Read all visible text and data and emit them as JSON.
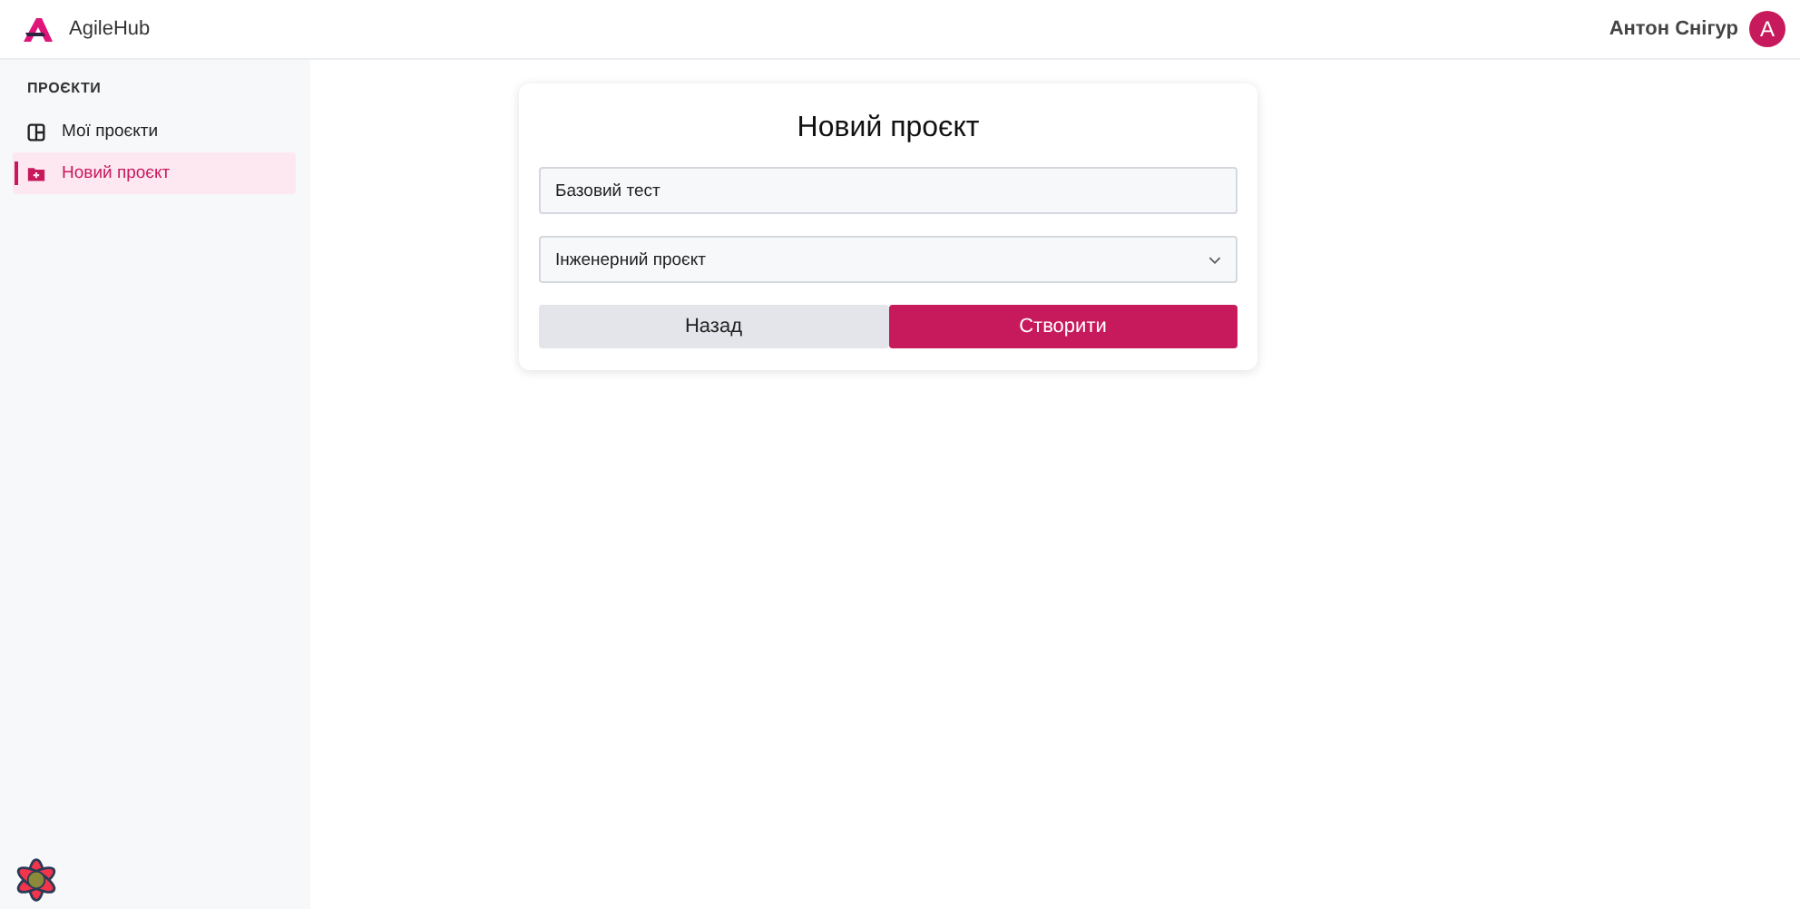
{
  "header": {
    "app_name": "AgileHub",
    "user_name": "Антон Снігур",
    "avatar_letter": "A"
  },
  "sidebar": {
    "section": "ПРОЄКТИ",
    "items": [
      {
        "label": "Мої проєкти",
        "kind": "board",
        "selected": false
      },
      {
        "label": "Новий проєкт",
        "kind": "folder",
        "selected": true
      }
    ]
  },
  "form": {
    "title": "Новий проєкт",
    "name_value": "Базовий тест",
    "type_value": "Інженерний проєкт",
    "buttons": [
      {
        "label": "Назад",
        "kind": "secondary"
      },
      {
        "label": "Створити",
        "kind": "primary"
      }
    ]
  }
}
